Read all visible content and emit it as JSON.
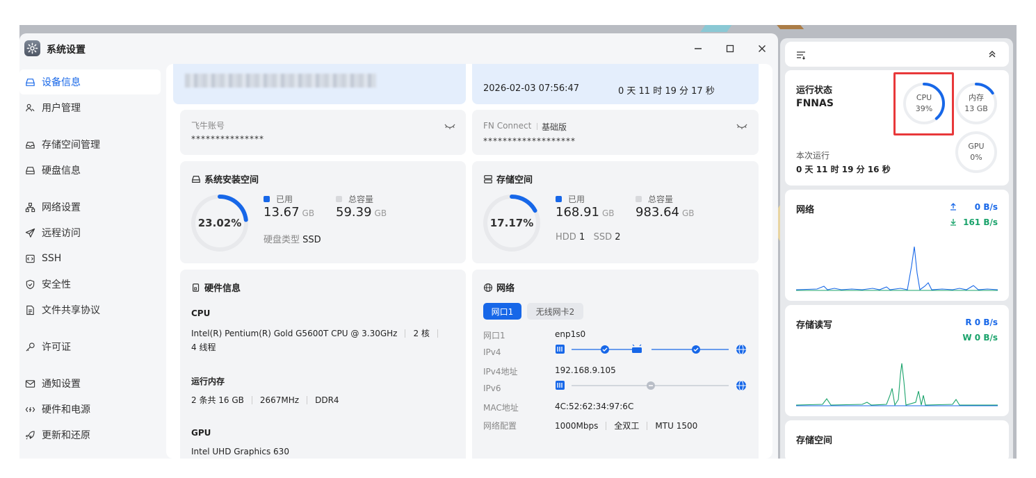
{
  "window": {
    "title": "系统设置"
  },
  "sidebar": {
    "items": [
      {
        "label": "设备信息",
        "icon": "drive-icon",
        "active": true
      },
      {
        "label": "用户管理",
        "icon": "users-icon"
      },
      {
        "label": "存储空间管理",
        "icon": "storage-icon"
      },
      {
        "label": "硬盘信息",
        "icon": "disk-icon"
      },
      {
        "label": "网络设置",
        "icon": "network-icon"
      },
      {
        "label": "远程访问",
        "icon": "send-icon"
      },
      {
        "label": "SSH",
        "icon": "terminal-icon"
      },
      {
        "label": "安全性",
        "icon": "shield-icon"
      },
      {
        "label": "文件共享协议",
        "icon": "file-icon"
      },
      {
        "label": "许可证",
        "icon": "key-icon"
      },
      {
        "label": "通知设置",
        "icon": "mail-icon"
      },
      {
        "label": "硬件和电源",
        "icon": "power-icon"
      },
      {
        "label": "更新和还原",
        "icon": "rocket-icon"
      }
    ]
  },
  "header_cards": {
    "datetime": "2026-02-03 07:56:47",
    "uptime": "0 天 11 时 19 分 17 秒"
  },
  "account": {
    "label": "飞牛账号",
    "value": "***************"
  },
  "fnconnect": {
    "label": "FN Connect",
    "edition": "基础版",
    "value": "*******************"
  },
  "system_space": {
    "title": "系统安装空间",
    "percent": "23.02%",
    "percent_value": 23.02,
    "used_label": "已用",
    "used_value": "13.67",
    "used_unit": "GB",
    "total_label": "总容量",
    "total_value": "59.39",
    "total_unit": "GB",
    "disk_type_label": "硬盘类型",
    "disk_type": "SSD"
  },
  "storage_space": {
    "title": "存储空间",
    "percent": "17.17%",
    "percent_value": 17.17,
    "used_label": "已用",
    "used_value": "168.91",
    "used_unit": "GB",
    "total_label": "总容量",
    "total_value": "983.64",
    "total_unit": "GB",
    "hdd_label": "HDD",
    "hdd_count": "1",
    "ssd_label": "SSD",
    "ssd_count": "2"
  },
  "hardware": {
    "title": "硬件信息",
    "cpu_title": "CPU",
    "cpu_model": "Intel(R) Pentium(R) Gold G5600T CPU @ 3.30GHz",
    "cpu_cores": "2 核",
    "cpu_threads": "4 线程",
    "mem_title": "运行内存",
    "mem_size": "2 条共 16 GB",
    "mem_speed": "2667MHz",
    "mem_type": "DDR4",
    "gpu_title": "GPU",
    "gpu_model": "Intel UHD Graphics 630"
  },
  "network": {
    "title": "网络",
    "tabs": [
      "网口1",
      "无线网卡2"
    ],
    "rows": {
      "port_label": "网口1",
      "port_value": "enp1s0",
      "ipv4_label": "IPv4",
      "ipv4_addr_label": "IPv4地址",
      "ipv4_addr_value": "192.168.9.105",
      "ipv6_label": "IPv6",
      "mac_label": "MAC地址",
      "mac_value": "4C:52:62:34:97:6C",
      "config_label": "网络配置",
      "speed": "1000Mbps",
      "duplex": "全双工",
      "mtu": "MTU 1500"
    }
  },
  "right_panel": {
    "status": {
      "title": "运行状态",
      "device": "FNNAS",
      "uptime_label": "本次运行",
      "uptime": "0 天 11 时 19 分 16 秒",
      "cpu_label": "CPU",
      "cpu_value": "39%",
      "cpu_fraction": 0.39,
      "mem_label": "内存",
      "mem_value": "13 GB",
      "mem_fraction": 0.16,
      "gpu_label": "GPU",
      "gpu_value": "0%",
      "gpu_fraction": 0
    },
    "net": {
      "title": "网络",
      "up": "0 B/s",
      "down": "161 B/s"
    },
    "disk_io": {
      "title": "存储读写",
      "read": "R  0 B/s",
      "write": "W  0 B/s"
    },
    "storage": {
      "title": "存储空间"
    }
  },
  "colors": {
    "accent": "#1767e8",
    "green": "#1aa36b",
    "highlight": "#e8383a",
    "ring_bg": "#e8e9ec"
  }
}
